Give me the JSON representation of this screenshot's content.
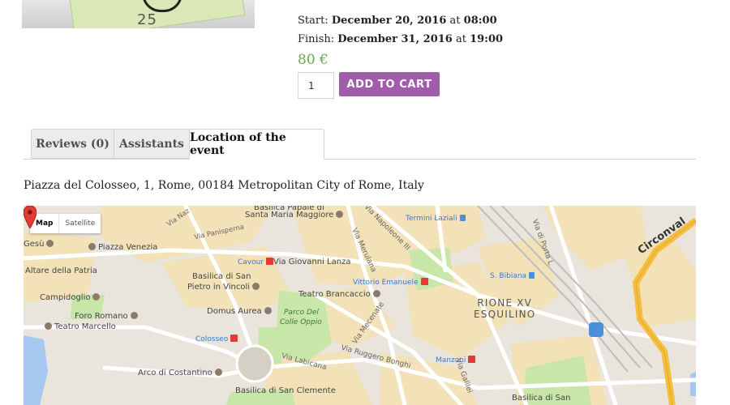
{
  "event": {
    "start_label": "Start:",
    "start_date": "December 20, 2016",
    "at_word_1": "at",
    "start_time": "08:00",
    "finish_label": "Finish:",
    "finish_date": "December 31, 2016",
    "at_word_2": "at",
    "finish_time": "19:00",
    "price": "80 €",
    "quantity": "1",
    "add_to_cart_label": "ADD TO CART"
  },
  "tabs": [
    {
      "label": "Reviews (0)",
      "active": false
    },
    {
      "label": "Assistants",
      "active": false
    },
    {
      "label": "Location of the event",
      "active": true
    }
  ],
  "address": "Piazza del Colosseo, 1, Rome, 00184 Metropolitan City of Rome, Italy",
  "map": {
    "type_buttons": {
      "map": "Map",
      "satellite": "Satellite"
    },
    "labels": {
      "basilica_papale": "Basilica Papale di",
      "santa_maria": "Santa Maria Maggiore",
      "via_nazionale": "Via Naz",
      "via_panisperna": "Via Panisperna",
      "gesu": "Gesù",
      "piazza_venezia": "Piazza Venezia",
      "altare": "Altare della Patria",
      "campidoglio": "Campidoglio",
      "foro_romano": "Foro Romano",
      "teatro_marcello": "Teatro Marcello",
      "arco": "Arco di Costantino",
      "cavour": "Cavour",
      "via_giovanni_lanza": "Via Giovanni Lanza",
      "basilica_san_pietro_1": "Basilica di San",
      "basilica_san_pietro_2": "Pietro in Vincoli",
      "domus_aurea": "Domus Aurea",
      "colosseo": "Colosseo",
      "teatro_brancaccio": "Teatro Brancaccio",
      "parco_1": "Parco Del",
      "parco_2": "Colle Oppio",
      "via_labicana": "Via Labicana",
      "via_ruggero_bonghi": "Via Ruggero Bonghi",
      "via_mecenate": "Via Mecenate",
      "basilica_clemente": "Basilica di San Clemente",
      "via_merulana": "Via Merulana",
      "vittorio_emanuele": "Vittorio Emanuele",
      "termini": "Termini Laziali",
      "via_napoleone": "Via Napoleone III",
      "s_bibiana": "S. Bibiana",
      "rione_1": "RIONE XV",
      "rione_2": "ESQUILINO",
      "manzoni": "Manzoni",
      "via_galilei": "Via Galilei",
      "basilica_bottom": "Basilica di San",
      "via_di_porta": "Via di Porta L",
      "circonval": "Circonval"
    }
  },
  "colors": {
    "button": "#a05eaa",
    "price": "#6aa84f",
    "marker": "#e53935",
    "park": "#c8e6a8",
    "block": "#f3e1b8",
    "ring_road": "#f4bf40",
    "water": "#a6c8f0"
  }
}
